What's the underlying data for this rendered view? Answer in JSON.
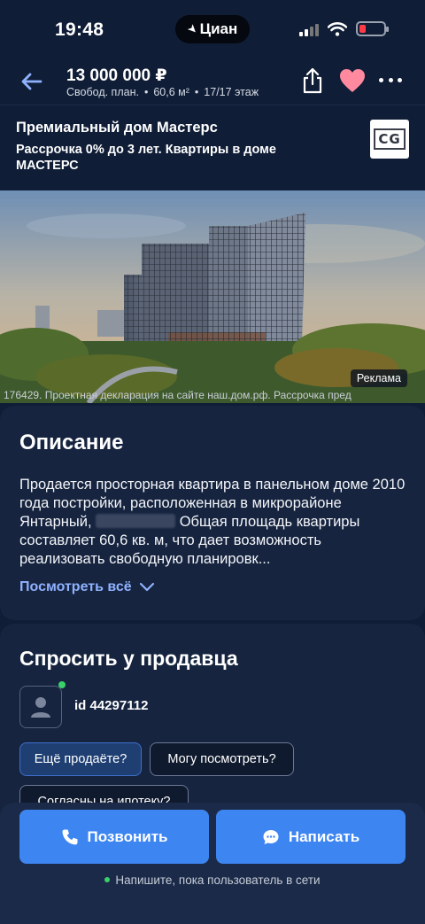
{
  "status_bar": {
    "time": "19:48",
    "app_name": "Циан",
    "battery_level": 0.25,
    "battery_color": "#ff3b47"
  },
  "header": {
    "price": "13 000 000 ₽",
    "layout": "Свобод. план.",
    "area": "60,6 м²",
    "floor": "17/17 этаж",
    "icons": [
      "arrow-left-icon",
      "share-icon",
      "heart-icon",
      "more-icon"
    ],
    "favorite_color": "#ff8aa0"
  },
  "ad": {
    "title": "Премиальный дом Мастерс",
    "subtitle": "Рассрочка 0% до 3 лет. Квартиры в доме МАСТЕРС",
    "logo_text": "CG",
    "label": "Реклама",
    "disclaimer": "176429. Проектная декларация на сайте наш.дом.рф. Рассрочка пред"
  },
  "description": {
    "title": "Описание",
    "text_before": "Продается просторная квартира в панельном доме 2010 года постройки, расположенная в микрорайоне Янтарный, ",
    "text_after": " Общая площадь квартиры составляет 60,6 кв. м, что дает возможность реализовать свободную планировк...",
    "more_label": "Посмотреть всё"
  },
  "seller": {
    "title": "Спросить у продавца",
    "id_label": "id 44297112",
    "quick_questions": [
      "Ещё продаёте?",
      "Могу посмотреть?",
      "Согласны на ипотеку?"
    ]
  },
  "actions": {
    "call_label": "Позвонить",
    "write_label": "Написать",
    "note": "Напишите, пока пользователь в сети",
    "accent_color": "#3d86f2"
  }
}
